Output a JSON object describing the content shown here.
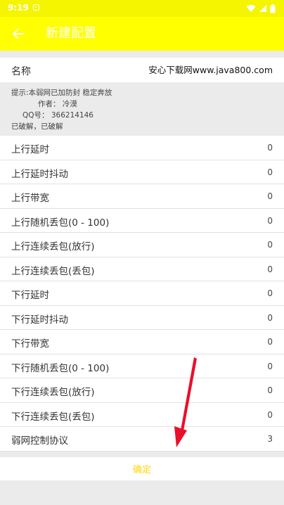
{
  "status_bar": {
    "time": "9:19"
  },
  "app_bar": {
    "title": "新建配置"
  },
  "name_field": {
    "label": "名称",
    "value": "安心下载网www.java800.com"
  },
  "tip": {
    "line1": "提示:本弱网已加防封 稳定奔放",
    "line2": "作者： 冷漠",
    "line3": "QQ号： 366214146",
    "line4": "已破解，已破解"
  },
  "settings": [
    {
      "label": "上行延时",
      "value": "0"
    },
    {
      "label": "上行延时抖动",
      "value": "0"
    },
    {
      "label": "上行带宽",
      "value": "0"
    },
    {
      "label": "上行随机丢包(0 - 100)",
      "value": "0"
    },
    {
      "label": "上行连续丢包(放行)",
      "value": "0"
    },
    {
      "label": "上行连续丢包(丢包)",
      "value": "0"
    },
    {
      "label": "下行延时",
      "value": "0"
    },
    {
      "label": "下行延时抖动",
      "value": "0"
    },
    {
      "label": "下行带宽",
      "value": "0"
    },
    {
      "label": "下行随机丢包(0 - 100)",
      "value": "0"
    },
    {
      "label": "下行连续丢包(放行)",
      "value": "0"
    },
    {
      "label": "下行连续丢包(丢包)",
      "value": "0"
    },
    {
      "label": "弱网控制协议",
      "value": "3"
    }
  ],
  "confirm": {
    "label": "确定"
  },
  "colors": {
    "accent": "#ffff00",
    "confirm_text": "#ffd700",
    "annotation_arrow": "#e8102b"
  }
}
